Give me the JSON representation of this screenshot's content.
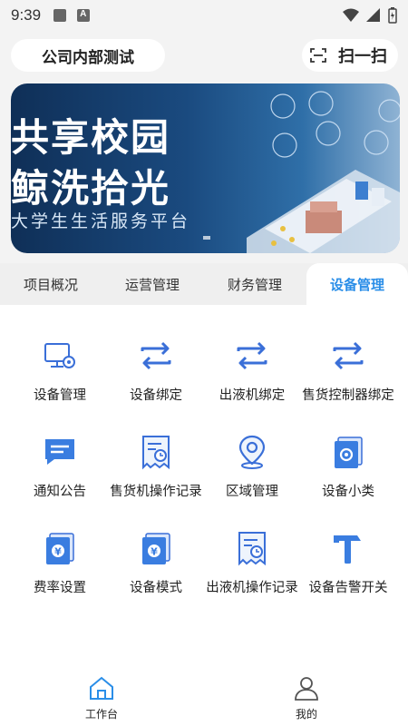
{
  "statusbar": {
    "time": "9:39"
  },
  "header": {
    "org_name": "公司内部测试",
    "scan_label": "扫一扫"
  },
  "banner": {
    "line1": "共享校园",
    "line2": "鲸洗拾光",
    "line3": "大学生生活服务平台"
  },
  "tabs": [
    {
      "label": "项目概况"
    },
    {
      "label": "运营管理"
    },
    {
      "label": "财务管理"
    },
    {
      "label": "设备管理"
    }
  ],
  "active_tab": "设备管理",
  "grid": [
    {
      "label": "设备管理",
      "icon": "monitor-gear-icon"
    },
    {
      "label": "设备绑定",
      "icon": "swap-arrows-icon"
    },
    {
      "label": "出液机绑定",
      "icon": "swap-arrows-icon"
    },
    {
      "label": "售货控制器绑定",
      "icon": "swap-arrows-icon"
    },
    {
      "label": "通知公告",
      "icon": "message-icon"
    },
    {
      "label": "售货机操作记录",
      "icon": "receipt-clock-icon"
    },
    {
      "label": "区域管理",
      "icon": "location-pin-icon"
    },
    {
      "label": "设备小类",
      "icon": "cards-gear-icon"
    },
    {
      "label": "费率设置",
      "icon": "yen-card-icon"
    },
    {
      "label": "设备模式",
      "icon": "yen-card-icon"
    },
    {
      "label": "出液机操作记录",
      "icon": "receipt-clock-icon"
    },
    {
      "label": "设备告警开关",
      "icon": "hammer-icon"
    }
  ],
  "bottom_nav": [
    {
      "label": "工作台",
      "icon": "home-icon"
    },
    {
      "label": "我的",
      "icon": "user-icon"
    }
  ],
  "colors": {
    "accent": "#2a8ee8",
    "icon_blue": "#3a6fd8"
  }
}
